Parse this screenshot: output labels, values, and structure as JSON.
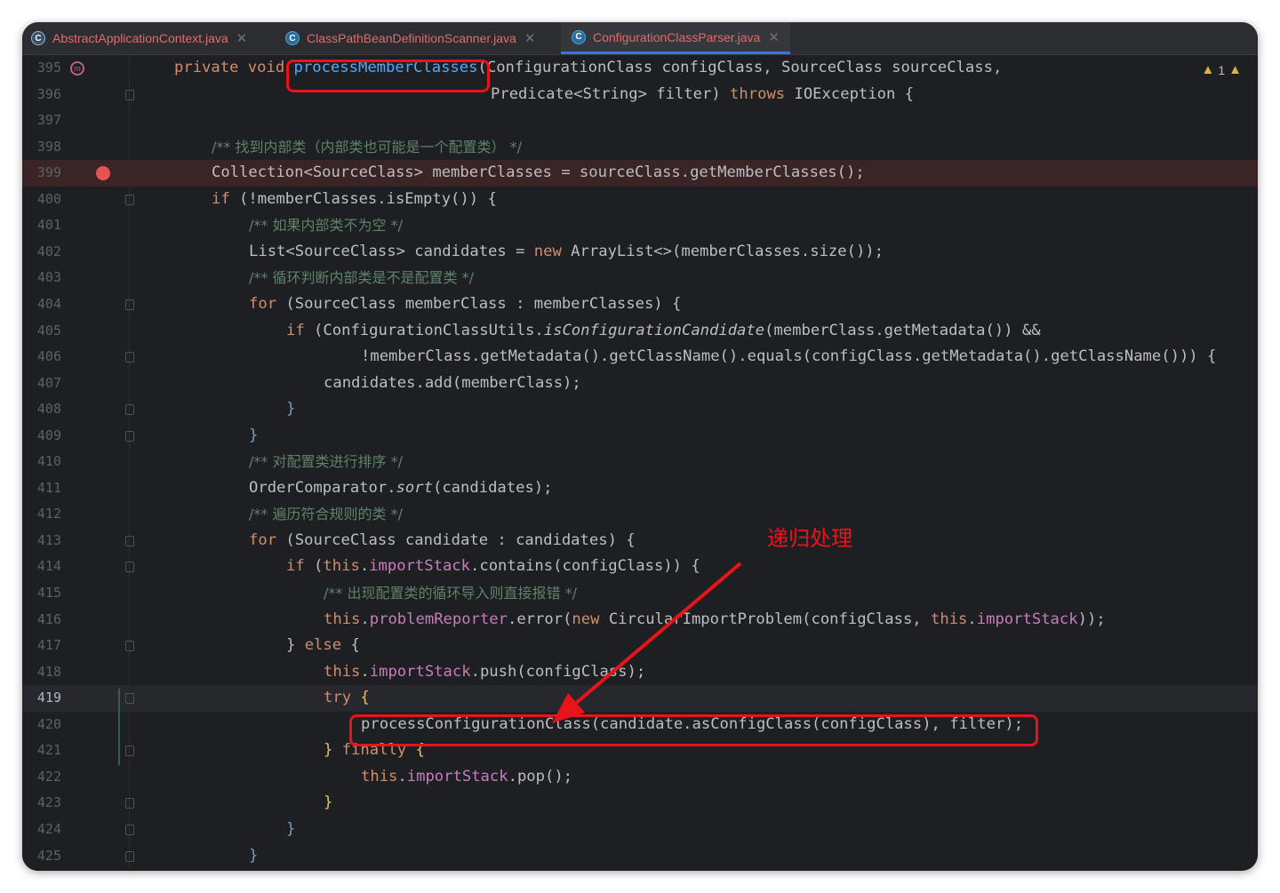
{
  "tabs": [
    {
      "label": "AbstractApplicationContext.java",
      "icon": "abstract-class-icon",
      "color": "#e06c6c",
      "active": false
    },
    {
      "label": "ClassPathBeanDefinitionScanner.java",
      "icon": "class-icon",
      "color": "#e06c6c",
      "active": false
    },
    {
      "label": "ConfigurationClassParser.java",
      "icon": "class-icon",
      "color": "#e06c6c",
      "active": true
    }
  ],
  "warnings": {
    "icon": "warning-icon",
    "count": "1"
  },
  "annotation": {
    "text": "递归处理",
    "color": "#e8141a"
  },
  "lines": [
    {
      "n": "395"
    },
    {
      "n": "396"
    },
    {
      "n": "397"
    },
    {
      "n": "398"
    },
    {
      "n": "399"
    },
    {
      "n": "400"
    },
    {
      "n": "401"
    },
    {
      "n": "402"
    },
    {
      "n": "403"
    },
    {
      "n": "404"
    },
    {
      "n": "405"
    },
    {
      "n": "406"
    },
    {
      "n": "407"
    },
    {
      "n": "408"
    },
    {
      "n": "409"
    },
    {
      "n": "410"
    },
    {
      "n": "411"
    },
    {
      "n": "412"
    },
    {
      "n": "413"
    },
    {
      "n": "414"
    },
    {
      "n": "415"
    },
    {
      "n": "416"
    },
    {
      "n": "417"
    },
    {
      "n": "418"
    },
    {
      "n": "419"
    },
    {
      "n": "420"
    },
    {
      "n": "421"
    },
    {
      "n": "422"
    },
    {
      "n": "423"
    },
    {
      "n": "424"
    },
    {
      "n": "425"
    }
  ],
  "code": {
    "l395a": "private void ",
    "l395b": "processMemberClasses",
    "l395c": "(ConfigurationClass configClass, SourceClass sourceClass,",
    "l396a": "Predicate<String> filter) ",
    "l396b": "throws",
    "l396c": " IOException {",
    "l398a": "/** ",
    "l398b": "找到内部类（内部类也可能是一个配置类）",
    "l398c": " */",
    "l399": "Collection<SourceClass> memberClasses = sourceClass.getMemberClasses();",
    "l400a": "if",
    "l400b": " (!memberClasses.isEmpty()) {",
    "l401a": "/** ",
    "l401b": "如果内部类不为空",
    "l401c": " */",
    "l402a": "List<SourceClass> candidates = ",
    "l402b": "new",
    "l402c": " ArrayList<>(memberClasses.size());",
    "l403a": "/** ",
    "l403b": "循环判断内部类是不是配置类",
    "l403c": " */",
    "l404a": "for",
    "l404b": " (SourceClass memberClass : memberClasses) {",
    "l405a": "if",
    "l405b": " (ConfigurationClassUtils.",
    "l405c": "isConfigurationCandidate",
    "l405d": "(memberClass.getMetadata()) &&",
    "l406": "!memberClass.getMetadata().getClassName().equals(configClass.getMetadata().getClassName())) {",
    "l407": "candidates.add(memberClass);",
    "l408": "}",
    "l409": "}",
    "l410a": "/** ",
    "l410b": "对配置类进行排序",
    "l410c": " */",
    "l411a": "OrderComparator.",
    "l411b": "sort",
    "l411c": "(candidates);",
    "l412a": "/** ",
    "l412b": "遍历符合规则的类",
    "l412c": " */",
    "l413a": "for",
    "l413b": " (SourceClass candidate : candidates) {",
    "l414a": "if",
    "l414b": " (",
    "l414c": "this",
    "l414d": ".",
    "l414e": "importStack",
    "l414f": ".contains(configClass)) {",
    "l415a": "/** ",
    "l415b": "出现配置类的循环导入则直接报错",
    "l415c": " */",
    "l416a": "this",
    "l416b": ".",
    "l416c": "problemReporter",
    "l416d": ".error(",
    "l416e": "new",
    "l416f": " CircularImportProblem(configClass, ",
    "l416g": "this",
    "l416h": ".",
    "l416i": "importStack",
    "l416j": "));",
    "l417a": "} ",
    "l417b": "else",
    "l417c": " {",
    "l418a": "this",
    "l418b": ".",
    "l418c": "importStack",
    "l418d": ".push(configClass);",
    "l419a": "try",
    "l419b": " {",
    "l420": "processConfigurationClass(candidate.asConfigClass(configClass), filter);",
    "l421a": "} ",
    "l421b": "finally",
    "l421c": " {",
    "l422a": "this",
    "l422b": ".",
    "l422c": "importStack",
    "l422d": ".pop();",
    "l423": "}",
    "l424": "}",
    "l425": "}"
  }
}
